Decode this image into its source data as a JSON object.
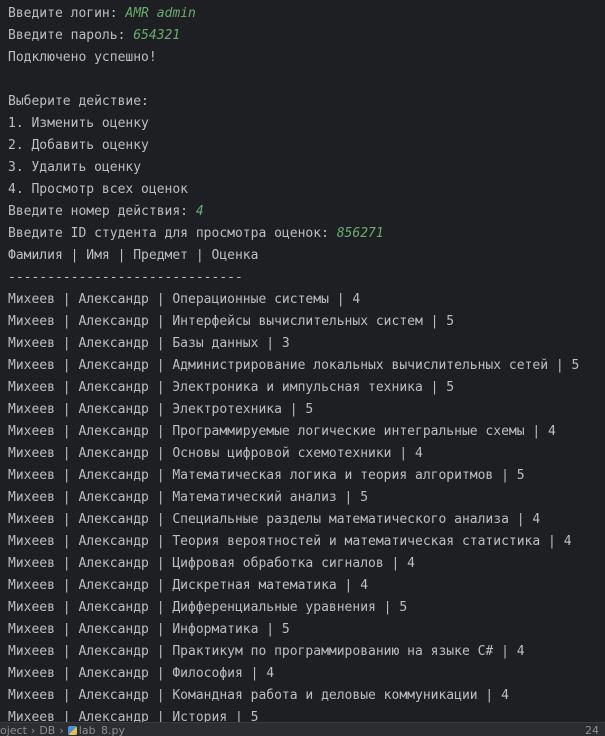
{
  "console": {
    "login_prompt": "Введите логин: ",
    "login_value": "AMR admin",
    "password_prompt": "Введите пароль: ",
    "password_value": "654321",
    "connected": "Подключено успешно!",
    "menu_title": "Выберите действие:",
    "menu_items": [
      "1. Изменить оценку",
      "2. Добавить оценку",
      "3. Удалить оценку",
      "4. Просмотр всех оценок"
    ],
    "action_prompt": "Введите номер действия: ",
    "action_value": "4",
    "student_prompt": "Введите ID студента для просмотра оценок: ",
    "student_value": "856271",
    "table_header": "Фамилия | Имя | Предмет | Оценка",
    "divider": "------------------------------",
    "rows": [
      "Михеев | Александр | Операционные системы | 4",
      "Михеев | Александр | Интерфейсы вычислительных систем | 5",
      "Михеев | Александр | Базы данных | 3",
      "Михеев | Александр | Администрирование локальных вычислительных сетей | 5",
      "Михеев | Александр | Электроника и импульсная техника | 5",
      "Михеев | Александр | Электротехника | 5",
      "Михеев | Александр | Программируемые логические интегральные схемы | 4",
      "Михеев | Александр | Основы цифровой схемотехники | 4",
      "Михеев | Александр | Математическая логика и теория алгоритмов | 5",
      "Михеев | Александр | Математический анализ | 5",
      "Михеев | Александр | Специальные разделы математического анализа | 4",
      "Михеев | Александр | Теория вероятностей и математическая статистика | 4",
      "Михеев | Александр | Цифровая обработка сигналов | 4",
      "Михеев | Александр | Дискретная математика | 4",
      "Михеев | Александр | Дифференциальные уравнения | 5",
      "Михеев | Александр | Информатика | 5",
      "Михеев | Александр | Практикум по программированию на языке C# | 4",
      "Михеев | Александр | Философия | 4",
      "Михеев | Александр | Командная работа и деловые коммуникации | 4",
      "Михеев | Александр | История | 5"
    ]
  },
  "statusbar": {
    "project": "oject",
    "folder": "DB",
    "file": "lab_8.py",
    "position": "24"
  },
  "colors": {
    "background": "#1e1f22",
    "text": "#bcbec4",
    "user_input": "#6aab73"
  }
}
